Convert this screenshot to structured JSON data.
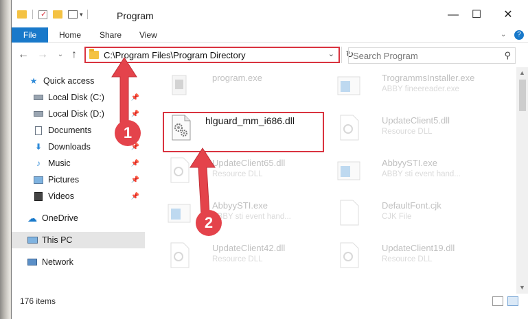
{
  "window": {
    "title": "Program",
    "controls": {
      "minimize": "—",
      "maximize": "☐",
      "close": "✕"
    }
  },
  "ribbon": {
    "tabs": [
      "File",
      "Home",
      "Share",
      "View"
    ],
    "help": "?"
  },
  "address": {
    "path": "C:\\Program Files\\Program Directory"
  },
  "search": {
    "placeholder": "Search Program"
  },
  "sidebar": {
    "items": [
      {
        "label": "Quick access",
        "icon": "star-icon",
        "pinned": false
      },
      {
        "label": "Local Disk (C:)",
        "icon": "drive-icon",
        "pinned": true
      },
      {
        "label": "Local Disk (D:)",
        "icon": "drive-icon",
        "pinned": true
      },
      {
        "label": "Documents",
        "icon": "document-icon",
        "pinned": true
      },
      {
        "label": "Downloads",
        "icon": "download-icon",
        "pinned": true
      },
      {
        "label": "Music",
        "icon": "music-icon",
        "pinned": true
      },
      {
        "label": "Pictures",
        "icon": "pictures-icon",
        "pinned": true
      },
      {
        "label": "Videos",
        "icon": "video-icon",
        "pinned": true
      },
      {
        "label": "OneDrive",
        "icon": "cloud-icon",
        "pinned": false
      },
      {
        "label": "This PC",
        "icon": "computer-icon",
        "pinned": false,
        "selected": true
      },
      {
        "label": "Network",
        "icon": "network-icon",
        "pinned": false
      }
    ]
  },
  "files": [
    {
      "name": "program.exe",
      "sub": "",
      "icon": "exe-icon",
      "faded": true
    },
    {
      "name": "TrogrammsInstaller.exe",
      "sub": "ABBY fineereader.exe",
      "icon": "installer-icon",
      "faded": true
    },
    {
      "name": "hlguard_mm_i686.dll",
      "sub": "",
      "icon": "dll-gear-icon",
      "faded": false
    },
    {
      "name": "UpdateClient5.dll",
      "sub": "Resource DLL",
      "icon": "dll-icon",
      "faded": true
    },
    {
      "name": "UpdateClient65.dll",
      "sub": "Resource DLL",
      "icon": "dll-icon",
      "faded": true
    },
    {
      "name": "AbbyySTI.exe",
      "sub": "ABBY sti event hand...",
      "icon": "app-window-icon",
      "faded": true
    },
    {
      "name": "AbbyySTI.exe",
      "sub": "ABBY sti event hand...",
      "icon": "app-window-icon",
      "faded": true
    },
    {
      "name": "DefaultFont.cjk",
      "sub": "CJK File",
      "icon": "blank-file-icon",
      "faded": true
    },
    {
      "name": "UpdateClient42.dll",
      "sub": "Resource DLL",
      "icon": "dll-icon",
      "faded": true
    },
    {
      "name": "UpdateClient19.dll",
      "sub": "Resource DLL",
      "icon": "dll-icon",
      "faded": true
    }
  ],
  "annotations": {
    "step1": "1",
    "step2": "2"
  },
  "status": {
    "items_count": "176 items"
  },
  "colors": {
    "accent": "#1979ca",
    "highlight": "#d9333f",
    "badge": "#e4434b"
  }
}
